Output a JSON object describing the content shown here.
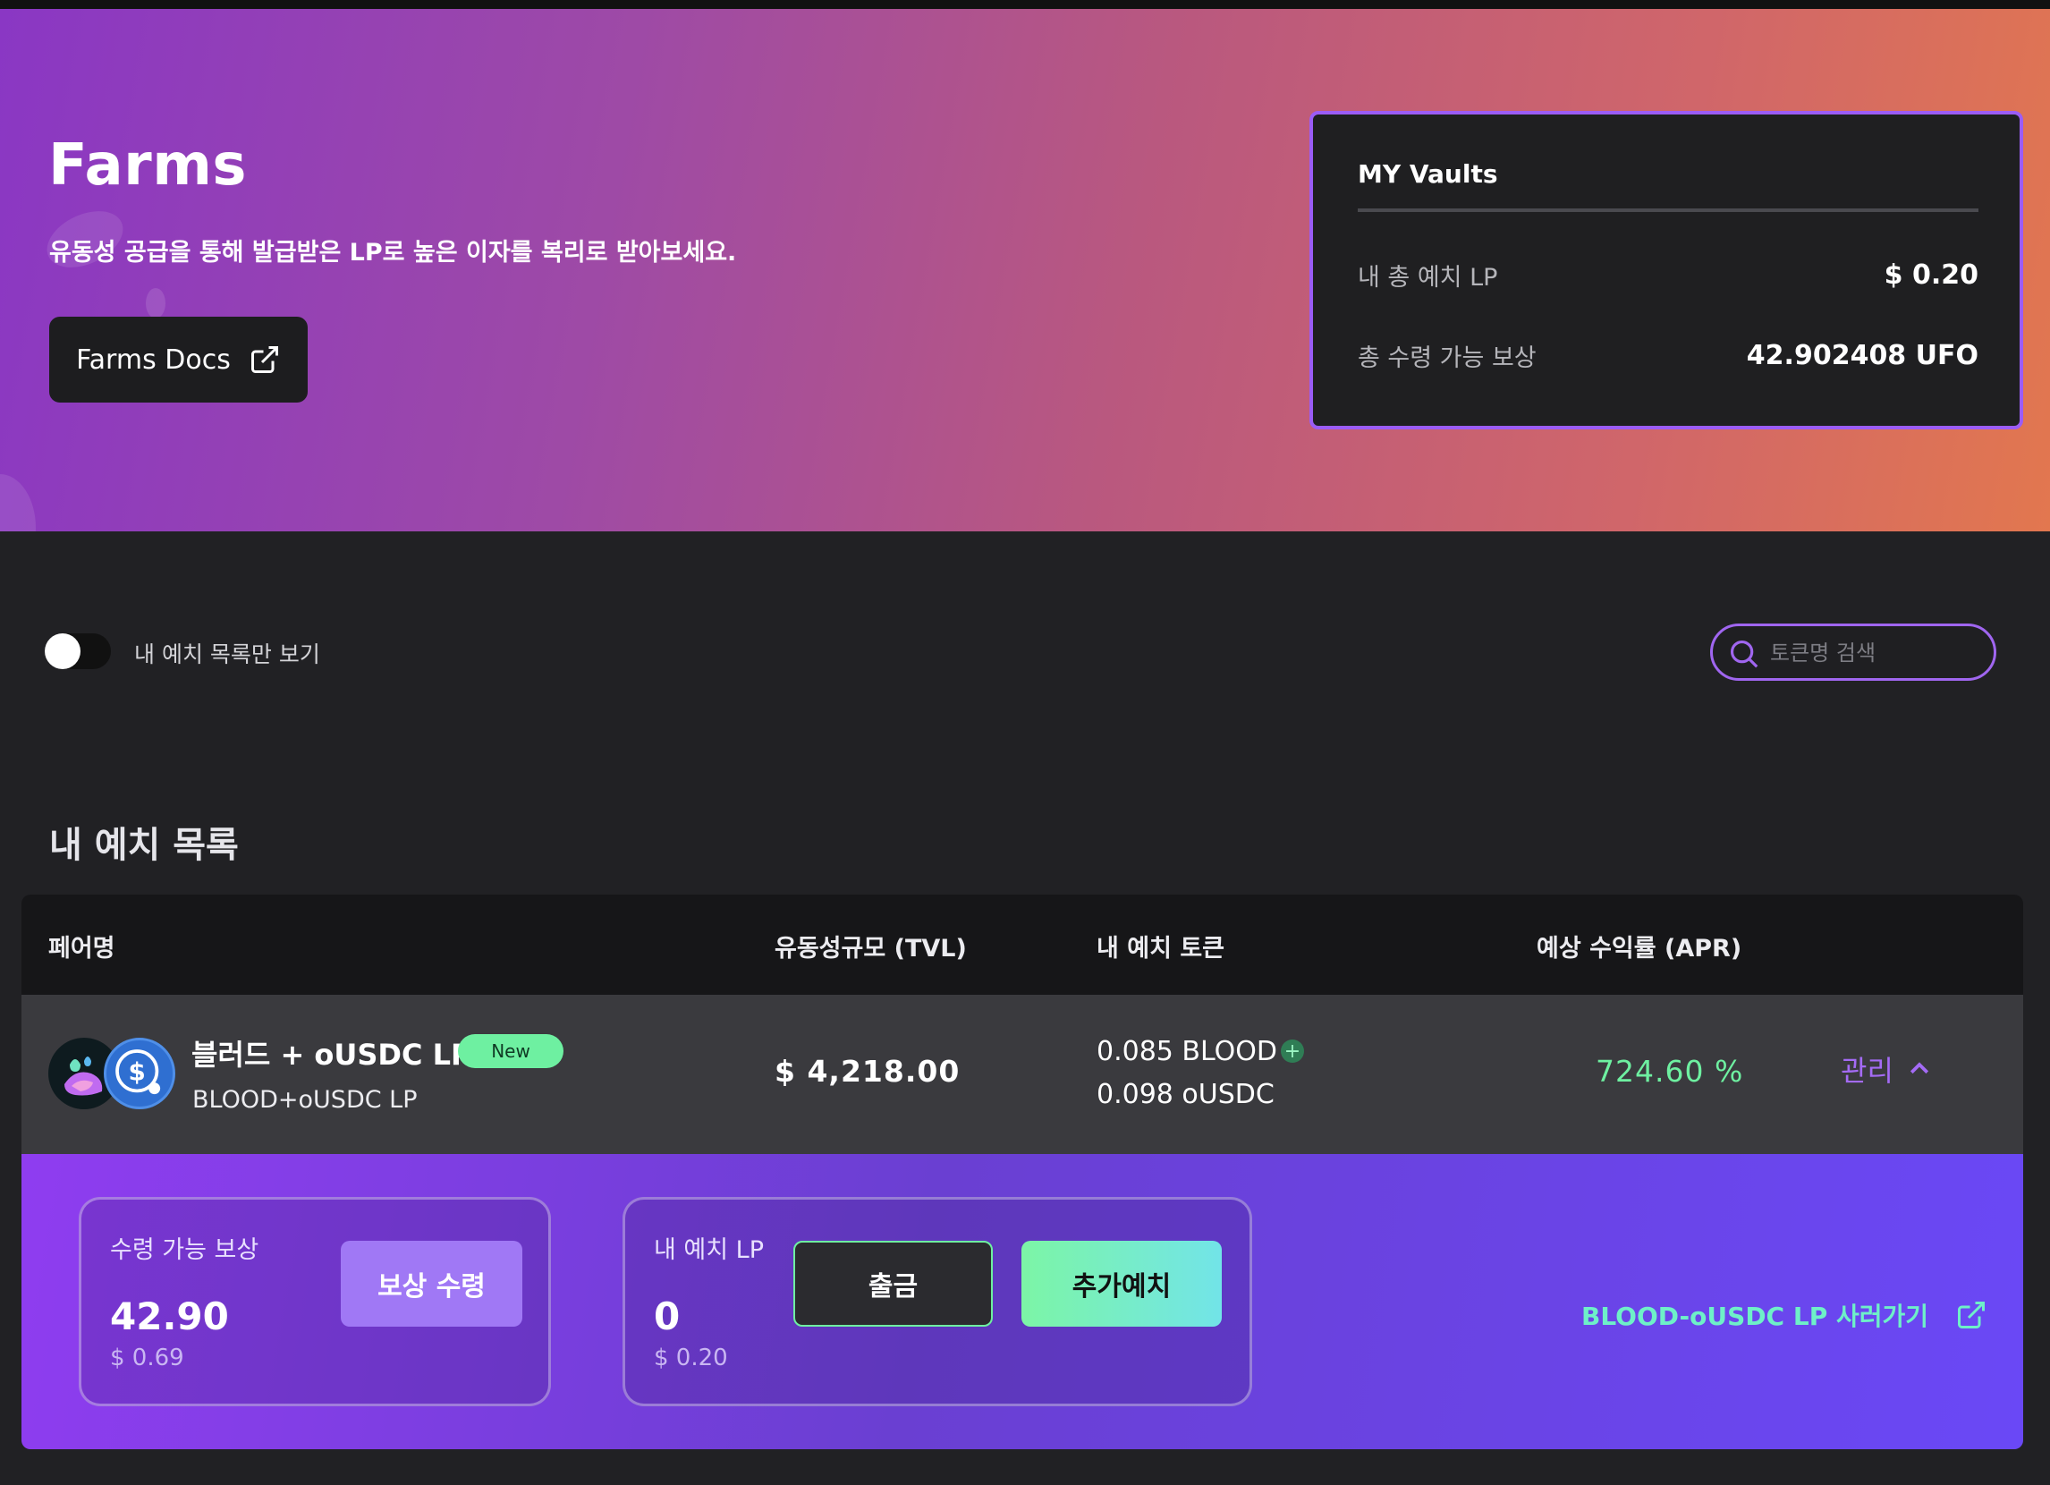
{
  "hero": {
    "title": "Farms",
    "subtitle": "유동성 공급을 통해 발급받은 LP로 높은 이자를 복리로 받아보세요.",
    "docs_button": "Farms Docs"
  },
  "vaults": {
    "title": "MY Vaults",
    "rows": [
      {
        "label": "내 총 예치 LP",
        "value": "$ 0.20"
      },
      {
        "label": "총 수령 가능 보상",
        "value": "42.902408  UFO"
      }
    ]
  },
  "filters": {
    "toggle_label": "내 예치 목록만 보기",
    "toggle_on": false,
    "search_placeholder": "토큰명 검색"
  },
  "section_title": "내 예치 목록",
  "table": {
    "headers": [
      "페어명",
      "유동성규모 (TVL)",
      "내 예치 토큰",
      "예상 수익률 (APR)"
    ],
    "rows": [
      {
        "pair_name": "블러드 + oUSDC LP",
        "badge": "New",
        "pair_sub": "BLOOD+oUSDC LP",
        "tvl": "$ 4,218.00",
        "token1": "0.085 BLOOD",
        "token2": "0.098 oUSDC",
        "apr": "724.60 %",
        "manage": "관리",
        "icons": [
          "blood-token-icon",
          "usdc-token-icon"
        ]
      }
    ]
  },
  "details": {
    "reward": {
      "label": "수령 가능 보상",
      "value": "42.90",
      "usd": "$ 0.69",
      "button": "보상 수령"
    },
    "deposit": {
      "label": "내 예치 LP",
      "value": "0",
      "usd": "$ 0.20",
      "withdraw_button": "출금",
      "deposit_button": "추가예치"
    },
    "buy_link": "BLOOD-oUSDC LP 사러가기"
  },
  "colors": {
    "accent_purple": "#9b5cf6",
    "apr_green": "#6ef0a1",
    "link_teal": "#6ef0c8"
  }
}
